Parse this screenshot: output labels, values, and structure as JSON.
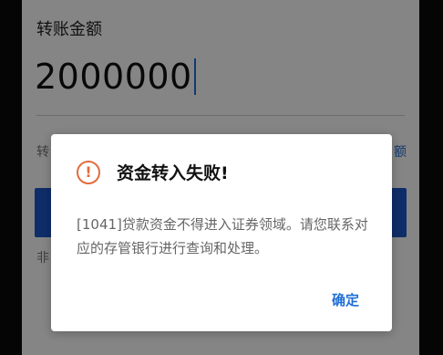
{
  "form": {
    "amount_label": "转账金额",
    "amount_value": "2000000",
    "hint_left": "转",
    "hint_right": "额",
    "note": "非"
  },
  "dialog": {
    "icon": "warning-icon",
    "title": "资金转入失败!",
    "message": "[1041]贷款资金不得进入证券领域。请您联系对应的存管银行进行查询和处理。",
    "ok_label": "确定"
  },
  "colors": {
    "accent": "#1f6fd6",
    "primary_button": "#1d56c8",
    "warning": "#e26d3f"
  }
}
